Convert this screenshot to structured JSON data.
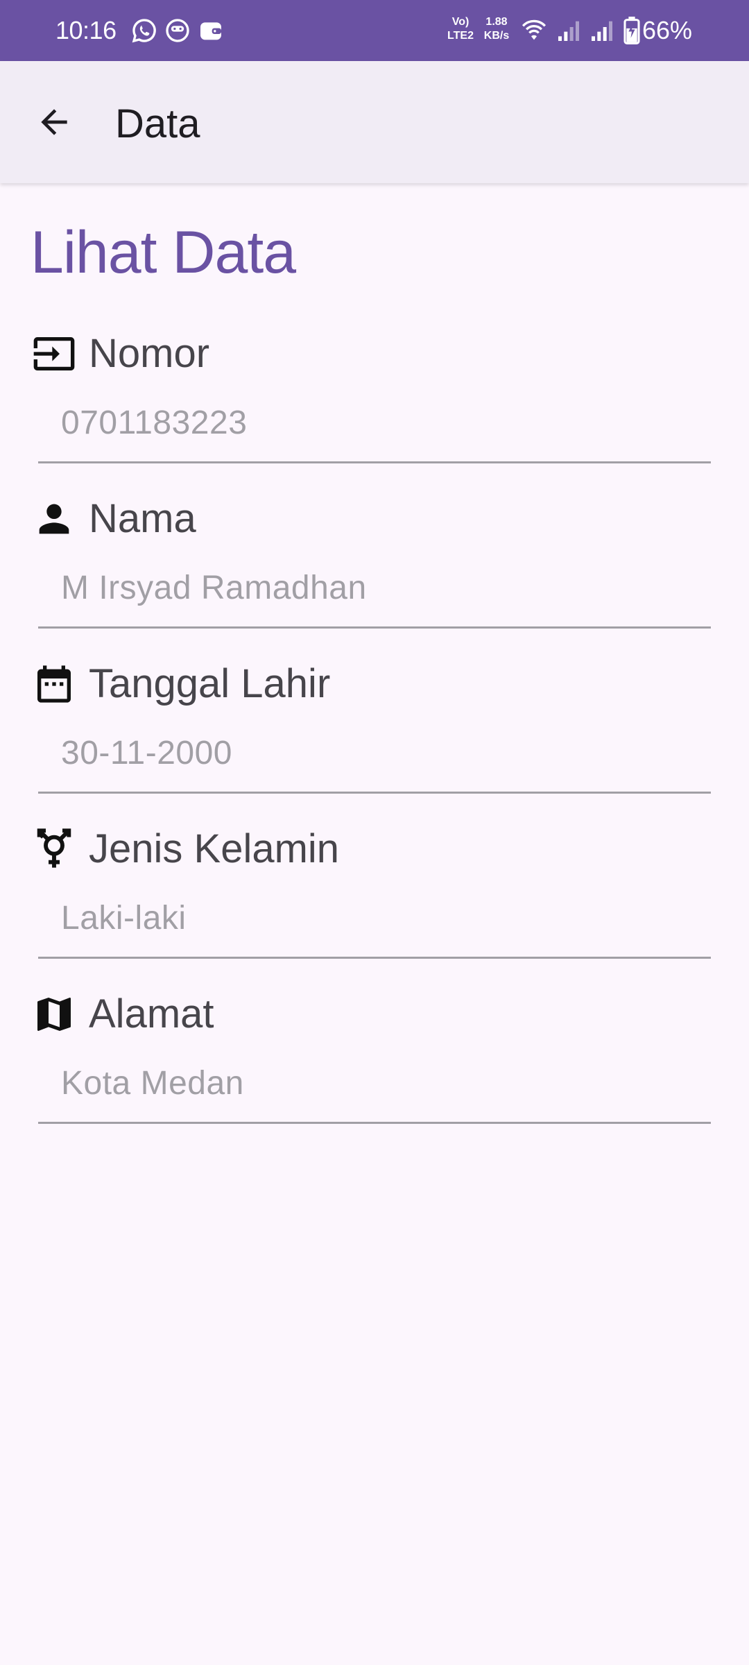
{
  "status_bar": {
    "time": "10:16",
    "network_speed_value": "1.88",
    "network_speed_unit": "KB/s",
    "volte_top": "Vo)",
    "volte_bottom": "LTE2",
    "battery_percent": "66%",
    "notification_icons": [
      "whatsapp-icon",
      "chat-bot-icon",
      "wallet-icon"
    ],
    "system_icons": [
      "wifi-icon",
      "signal-1-icon",
      "signal-2-icon",
      "battery-charging-icon"
    ],
    "background_color": "#6a52a3"
  },
  "app_bar": {
    "title": "Data",
    "back_icon": "arrow-back-icon",
    "background_color": "#f1ecf5"
  },
  "page": {
    "heading": "Lihat Data",
    "heading_color": "#6a52a3",
    "background_color": "#fcf6fd"
  },
  "fields": [
    {
      "icon": "input-icon",
      "label": "Nomor",
      "value": "0701183223"
    },
    {
      "icon": "person-icon",
      "label": "Nama",
      "value": "M Irsyad Ramadhan"
    },
    {
      "icon": "calendar-icon",
      "label": "Tanggal Lahir",
      "value": "30-11-2000"
    },
    {
      "icon": "transgender-icon",
      "label": "Jenis Kelamin",
      "value": "Laki-laki"
    },
    {
      "icon": "map-icon",
      "label": "Alamat",
      "value": "Kota Medan"
    }
  ]
}
